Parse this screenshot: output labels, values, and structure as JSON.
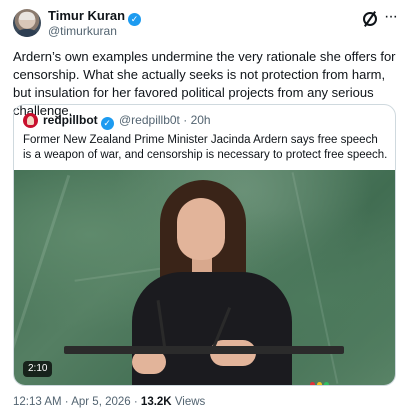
{
  "author": {
    "name": "Timur Kuran",
    "handle": "@timurkuran"
  },
  "tweet": {
    "text": "Ardern’s own examples undermine the very rationale she offers for censorship. What she actually seeks is not protection from harm, but insulation for her favored political projects from any serious challenge."
  },
  "quoted": {
    "name": "redpillbot",
    "handle": "@redpillb0t",
    "separator": "·",
    "age": "20h",
    "text": "Former New Zealand Prime Minister Jacinda Ardern says free speech is a weapon of war, and censorship is necessary to protect free speech.",
    "video": {
      "duration": "2:10"
    }
  },
  "footer": {
    "time": "12:13 AM",
    "dot1": "·",
    "date": "Apr 5, 2026",
    "dot2": "·",
    "views_count": "13.2K",
    "views_label": "Views"
  },
  "colors": {
    "verified": "#1d9bf0",
    "secondary_text": "#536471",
    "border": "#cfd9de"
  },
  "icons": [
    "grok-icon",
    "more-options-icon",
    "verified-badge-icon"
  ]
}
